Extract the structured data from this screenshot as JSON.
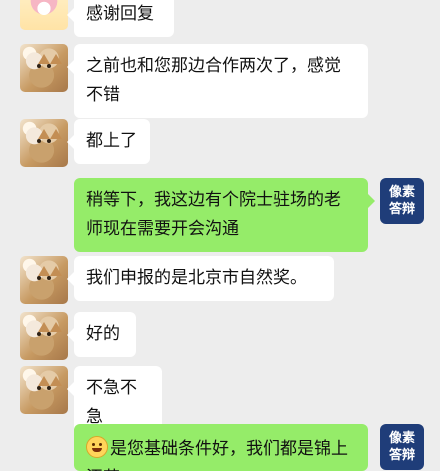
{
  "chat": {
    "messages": [
      {
        "side": "left",
        "text": "感谢回复"
      },
      {
        "side": "left",
        "text": "之前也和您那边合作两次了，感觉不错"
      },
      {
        "side": "left",
        "text": "都上了"
      },
      {
        "side": "right",
        "text": "稍等下，我这边有个院士驻场的老师现在需要开会沟通"
      },
      {
        "side": "left",
        "text": "我们申报的是北京市自然奖。"
      },
      {
        "side": "left",
        "text": "好的"
      },
      {
        "side": "left",
        "text": "不急不急"
      },
      {
        "side": "right",
        "text": "是您基础条件好，我们都是锦上添花"
      }
    ],
    "tag": {
      "line1": "像素",
      "line2": "答辩"
    }
  }
}
